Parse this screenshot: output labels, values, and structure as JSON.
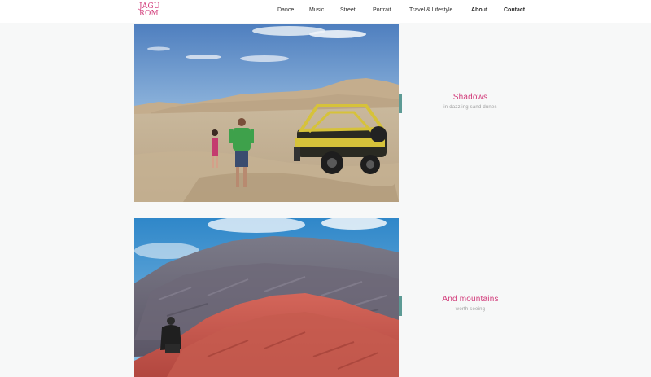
{
  "logo": {
    "line1": "JAGU",
    "line2": "ROM"
  },
  "nav": [
    {
      "label": "Dance",
      "bold": false
    },
    {
      "label": "Music",
      "bold": false
    },
    {
      "label": "Street",
      "bold": false
    },
    {
      "label": "Portrait",
      "bold": false
    },
    {
      "label": "Travel & Lifestyle",
      "bold": false
    },
    {
      "label": "About",
      "bold": true
    },
    {
      "label": "Contact",
      "bold": true
    }
  ],
  "gallery": [
    {
      "title": "Shadows",
      "subtitle": "in dazzling sand dunes",
      "image": "desert-dunes-buggy-photo"
    },
    {
      "title": "And mountains",
      "subtitle": "worth seeing",
      "image": "red-mountain-photo"
    }
  ],
  "colors": {
    "accent": "#d23b7a",
    "tab": "#5d9b95",
    "background": "#f7f8f8"
  }
}
